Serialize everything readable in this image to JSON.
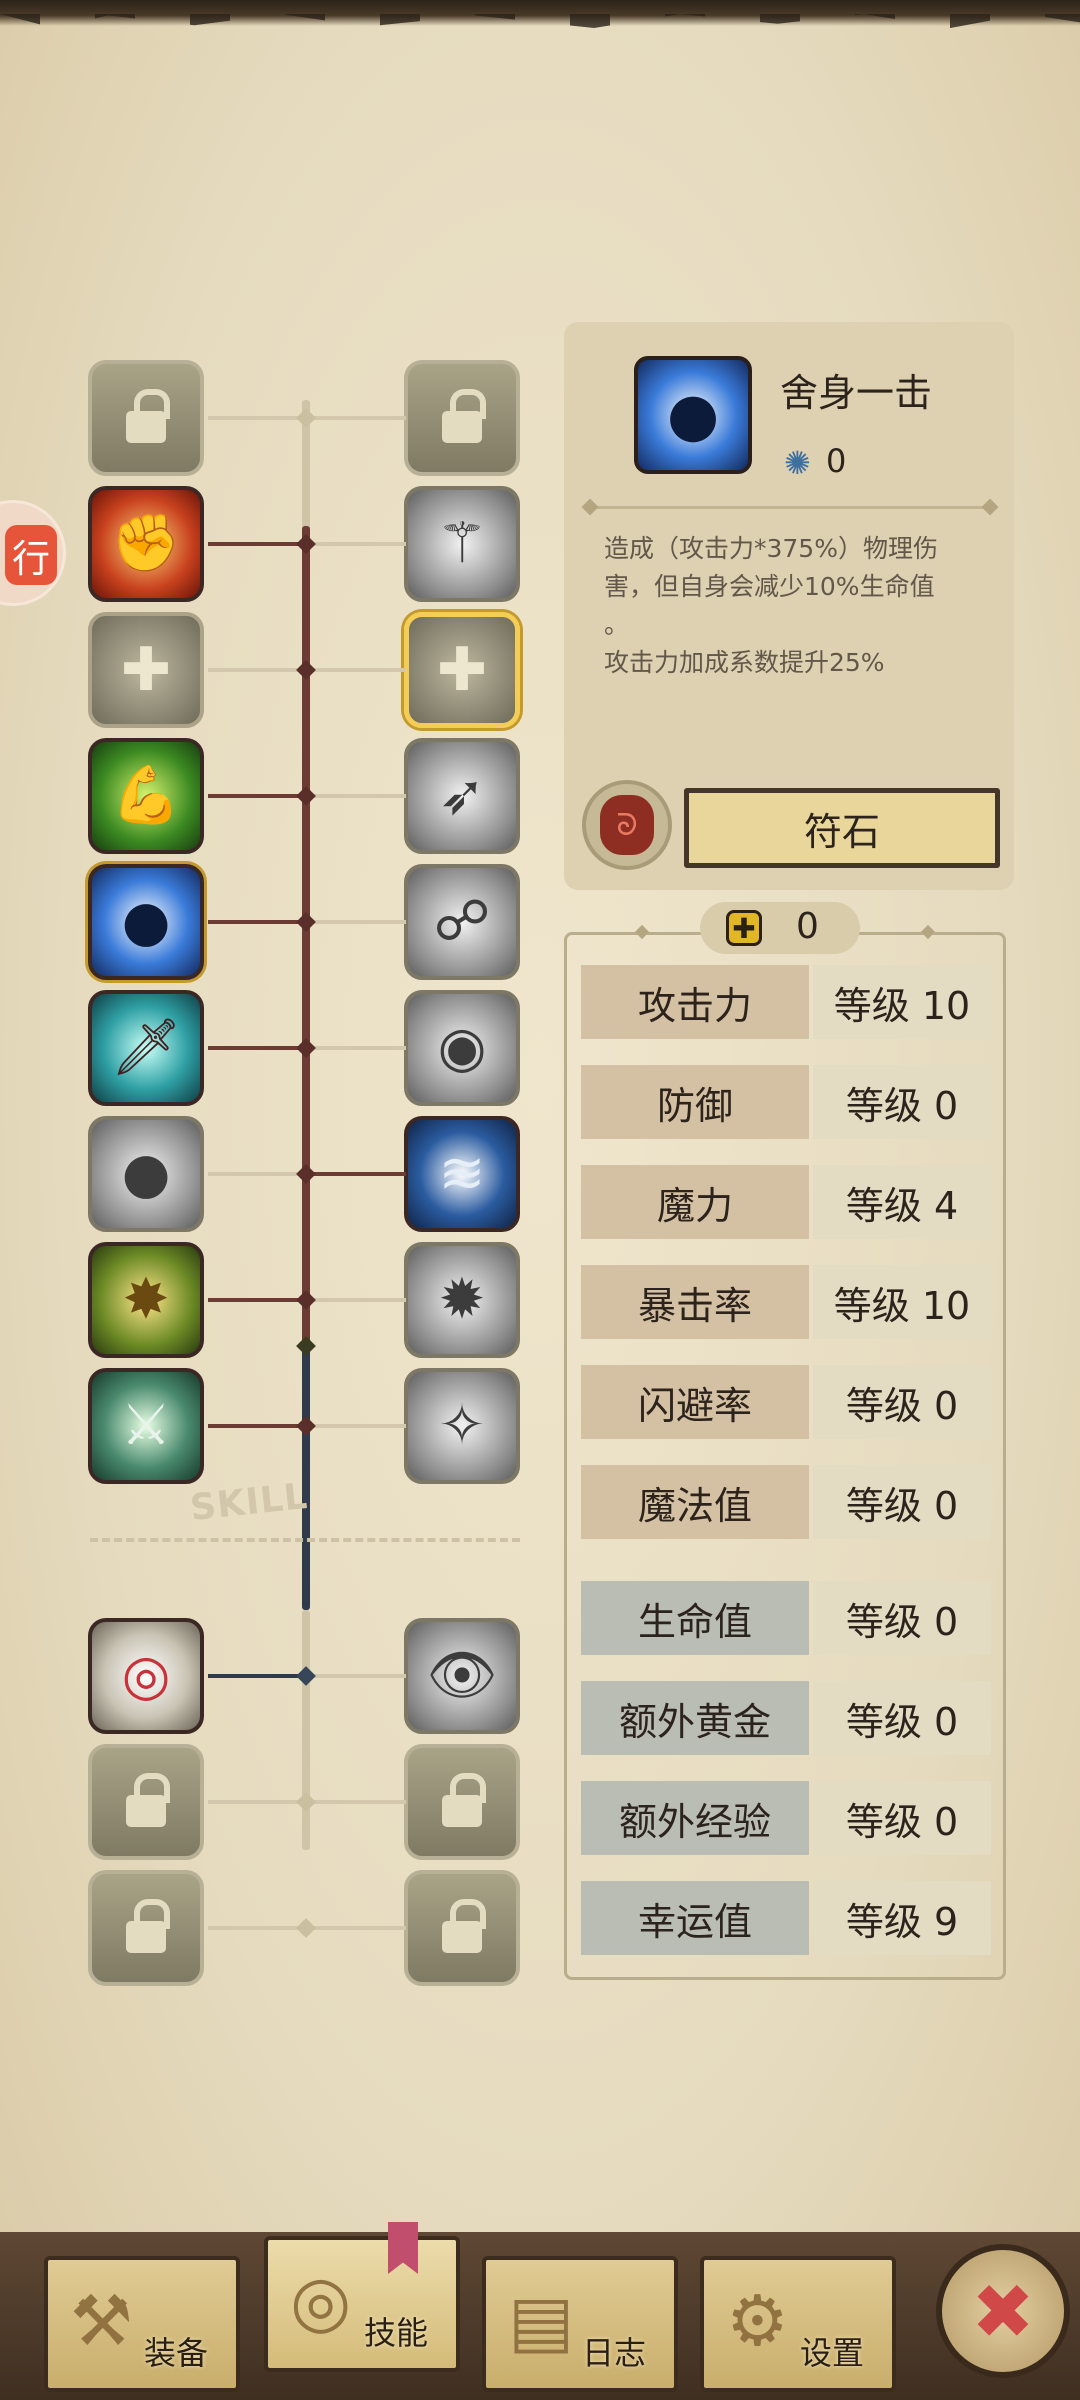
{
  "side_badge": "行",
  "tree_label": "SKILL",
  "skills_left": [
    {
      "name": "lock-icon",
      "state": "locked"
    },
    {
      "name": "fist-strike-icon",
      "state": "unlocked"
    },
    {
      "name": "plus-icon",
      "state": "empty"
    },
    {
      "name": "muscle-arm-icon",
      "state": "unlocked"
    },
    {
      "name": "shadow-slash-icon",
      "state": "selected"
    },
    {
      "name": "dagger-icon",
      "state": "unlocked"
    },
    {
      "name": "shadow-figure-icon",
      "state": "gray"
    },
    {
      "name": "golden-armor-icon",
      "state": "unlocked"
    },
    {
      "name": "crossed-swords-icon",
      "state": "unlocked"
    },
    {
      "name": "target-trap-icon",
      "state": "unlocked"
    },
    {
      "name": "lock-icon",
      "state": "locked"
    },
    {
      "name": "lock-icon",
      "state": "locked"
    }
  ],
  "skills_right": [
    {
      "name": "shield-lock-icon",
      "state": "locked"
    },
    {
      "name": "blade-slash-icon",
      "state": "gray"
    },
    {
      "name": "plus-icon",
      "state": "empty-highlight"
    },
    {
      "name": "dash-figure-icon",
      "state": "gray"
    },
    {
      "name": "double-figure-icon",
      "state": "gray"
    },
    {
      "name": "eye-burst-icon",
      "state": "gray"
    },
    {
      "name": "wave-blade-icon",
      "state": "unlocked"
    },
    {
      "name": "spiked-orb-icon",
      "state": "gray"
    },
    {
      "name": "sparkle-figure-icon",
      "state": "gray"
    },
    {
      "name": "eye-tower-icon",
      "state": "gray"
    },
    {
      "name": "lock-icon",
      "state": "locked"
    },
    {
      "name": "lock-icon",
      "state": "locked"
    }
  ],
  "info": {
    "name": "舍身一击",
    "level": "0",
    "description_lines": [
      "造成（攻击力*375%）物理伤",
      "害，但自身会减少10%生命值",
      "。",
      "攻击力加成系数提升25%"
    ],
    "rune_glyph": "ᘐ",
    "rune_button": "符石"
  },
  "points": "0",
  "stats": [
    {
      "name": "攻击力",
      "level": "等级 10",
      "group": "tan"
    },
    {
      "name": "防御",
      "level": "等级 0",
      "group": "tan"
    },
    {
      "name": "魔力",
      "level": "等级 4",
      "group": "tan"
    },
    {
      "name": "暴击率",
      "level": "等级 10",
      "group": "tan"
    },
    {
      "name": "闪避率",
      "level": "等级 0",
      "group": "tan"
    },
    {
      "name": "魔法值",
      "level": "等级 0",
      "group": "tan"
    },
    {
      "name": "生命值",
      "level": "等级 0",
      "group": "blue"
    },
    {
      "name": "额外黄金",
      "level": "等级 0",
      "group": "blue"
    },
    {
      "name": "额外经验",
      "level": "等级 0",
      "group": "blue"
    },
    {
      "name": "幸运值",
      "level": "等级 9",
      "group": "blue"
    }
  ],
  "nav": [
    {
      "label": "装备",
      "icon": "axe-icon",
      "glyph": "⚒"
    },
    {
      "label": "技能",
      "icon": "skill-ring-icon",
      "glyph": "◎"
    },
    {
      "label": "日志",
      "icon": "journal-icon",
      "glyph": "▤"
    },
    {
      "label": "设置",
      "icon": "settings-gear-icon",
      "glyph": "⚙"
    }
  ],
  "close_glyph": "✖"
}
